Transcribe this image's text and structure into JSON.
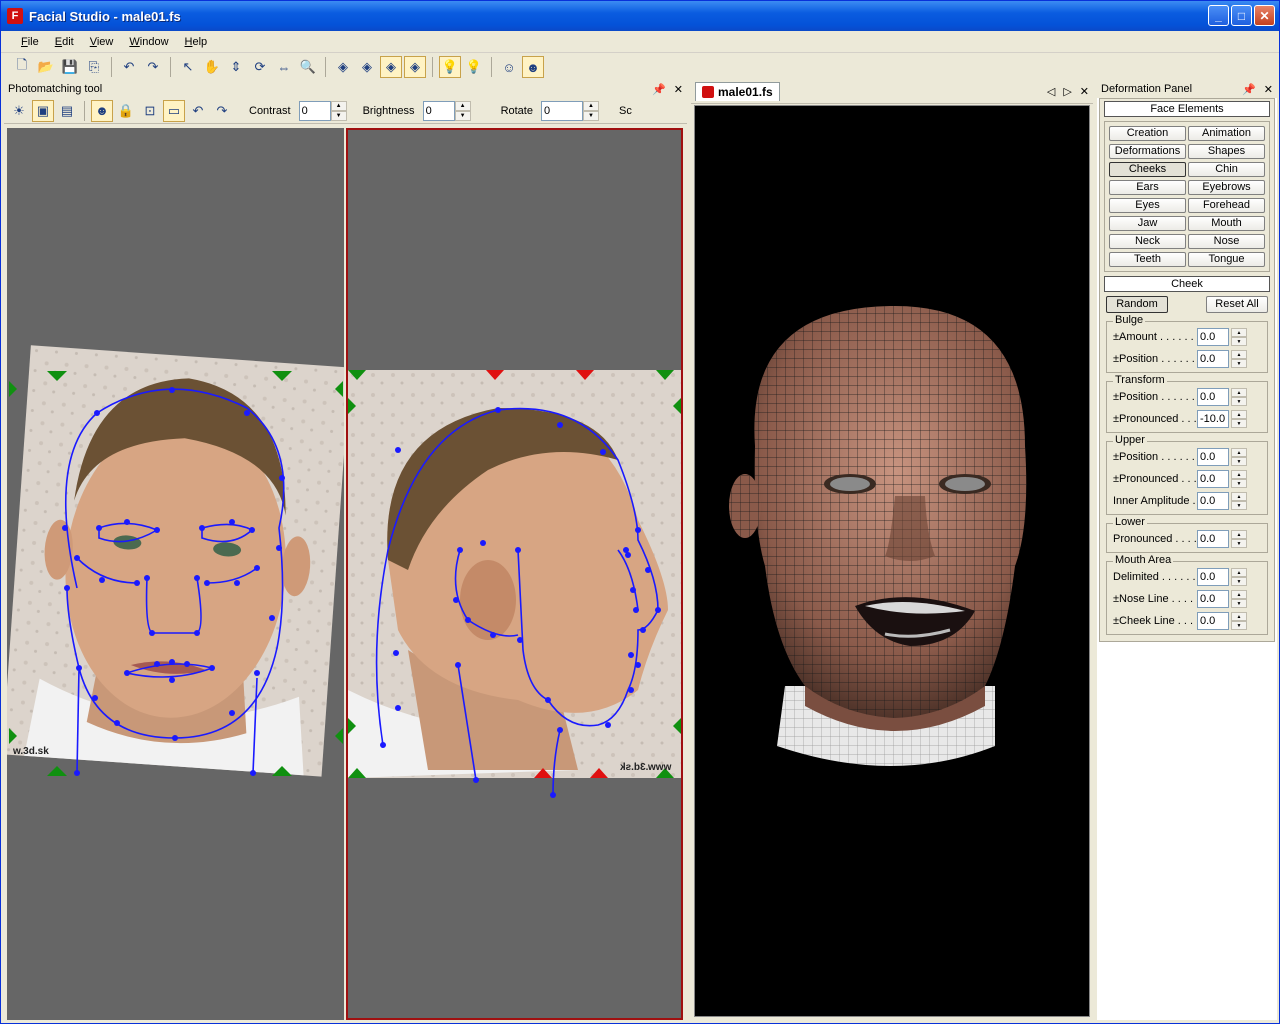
{
  "window": {
    "title": "Facial Studio - male01.fs",
    "minimize": "_",
    "maximize": "□",
    "close": "✕"
  },
  "menu": [
    "File",
    "Edit",
    "View",
    "Window",
    "Help"
  ],
  "photomatching": {
    "title": "Photomatching tool",
    "pin": "📌",
    "close": "✕",
    "contrast_label": "Contrast",
    "contrast_value": "0",
    "brightness_label": "Brightness",
    "brightness_value": "0",
    "rotate_label": "Rotate",
    "rotate_value": "0",
    "scale_label_partial": "Sc",
    "watermark_front": "w.3d.sk",
    "watermark_side": "www.3d.sk"
  },
  "document": {
    "tab_label": "male01.fs",
    "nav_prev": "◁",
    "nav_next": "▷",
    "close": "✕"
  },
  "deformation": {
    "title": "Deformation Panel",
    "pin": "📌",
    "close": "✕",
    "face_elements_header": "Face Elements",
    "face_buttons": [
      "Creation",
      "Animation",
      "Deformations",
      "Shapes",
      "Cheeks",
      "Chin",
      "Ears",
      "Eyebrows",
      "Eyes",
      "Forehead",
      "Jaw",
      "Mouth",
      "Neck",
      "Nose",
      "Teeth",
      "Tongue"
    ],
    "active_button": "Cheeks",
    "cheek_header": "Cheek",
    "random_label": "Random",
    "reset_label": "Reset All",
    "groups": [
      {
        "name": "Bulge",
        "rows": [
          {
            "label": "±Amount . . . . . . .",
            "value": "0.0"
          },
          {
            "label": "±Position . . . . . .",
            "value": "0.0"
          }
        ]
      },
      {
        "name": "Transform",
        "rows": [
          {
            "label": "±Position . . . . . .",
            "value": "0.0"
          },
          {
            "label": "±Pronounced . . .",
            "value": "-10.0"
          }
        ]
      },
      {
        "name": "Upper",
        "rows": [
          {
            "label": "±Position . . . . . .",
            "value": "0.0"
          },
          {
            "label": "±Pronounced . . .",
            "value": "0.0"
          },
          {
            "label": "Inner Amplitude .",
            "value": "0.0"
          }
        ]
      },
      {
        "name": "Lower",
        "rows": [
          {
            "label": "Pronounced . . . .",
            "value": "0.0"
          }
        ]
      },
      {
        "name": "Mouth Area",
        "rows": [
          {
            "label": "Delimited . . . . . .",
            "value": "0.0"
          },
          {
            "label": "±Nose Line . . . .",
            "value": "0.0"
          },
          {
            "label": "±Cheek Line . . . .",
            "value": "0.0"
          }
        ]
      }
    ]
  },
  "colors": {
    "accent": "#0452d8",
    "wireframe": "#1a1a1a",
    "landmark": "#1a1aff",
    "marker_green": "#109010",
    "marker_red": "#e01010"
  }
}
